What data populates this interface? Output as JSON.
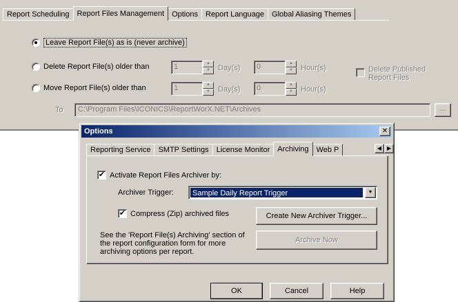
{
  "back_window": {
    "tabs": [
      "Report Scheduling",
      "Report Files Management",
      "Options",
      "Report Language",
      "Global Aliasing Themes"
    ],
    "active_tab": "Report Files Management",
    "radio_leave_label": "Leave Report File(s) as is (never archive)",
    "radio_delete_label": "Delete Report File(s) older than",
    "radio_move_label": "Move Report File(s) older than",
    "delete_days_value": "1",
    "delete_hours_value": "0",
    "move_days_value": "1",
    "move_hours_value": "0",
    "days_unit": "Day(s)",
    "hours_unit": "Hour(s)",
    "delete_published_label": "Delete Published Report Files",
    "to_label": "To",
    "path_value": "C:\\Program Files\\ICONICS\\ReportWorX.NET\\Archives",
    "browse_label": "..."
  },
  "dialog": {
    "title": "Options",
    "close_glyph": "✕",
    "tabs": [
      "Reporting Service",
      "SMTP Settings",
      "License Monitor",
      "Archiving",
      "Web P"
    ],
    "active_tab": "Archiving",
    "scroll_left": "◀",
    "scroll_right": "▶",
    "activate_label": "Activate Report Files Archiver by:",
    "trigger_label": "Archiver Trigger:",
    "trigger_value": "Sample Daily Report Trigger",
    "compress_label": "Compress (Zip) archived files",
    "create_trigger_label": "Create New Archiver Trigger...",
    "archive_now_label": "Archive Now",
    "info_text": "See the 'Report File(s) Archiving' section of the report configuration form for more archiving options per report.",
    "ok_label": "OK",
    "cancel_label": "Cancel",
    "help_label": "Help"
  },
  "glyphs": {
    "check": "✔",
    "up": "▲",
    "down": "▼",
    "dropdown": "▼"
  }
}
